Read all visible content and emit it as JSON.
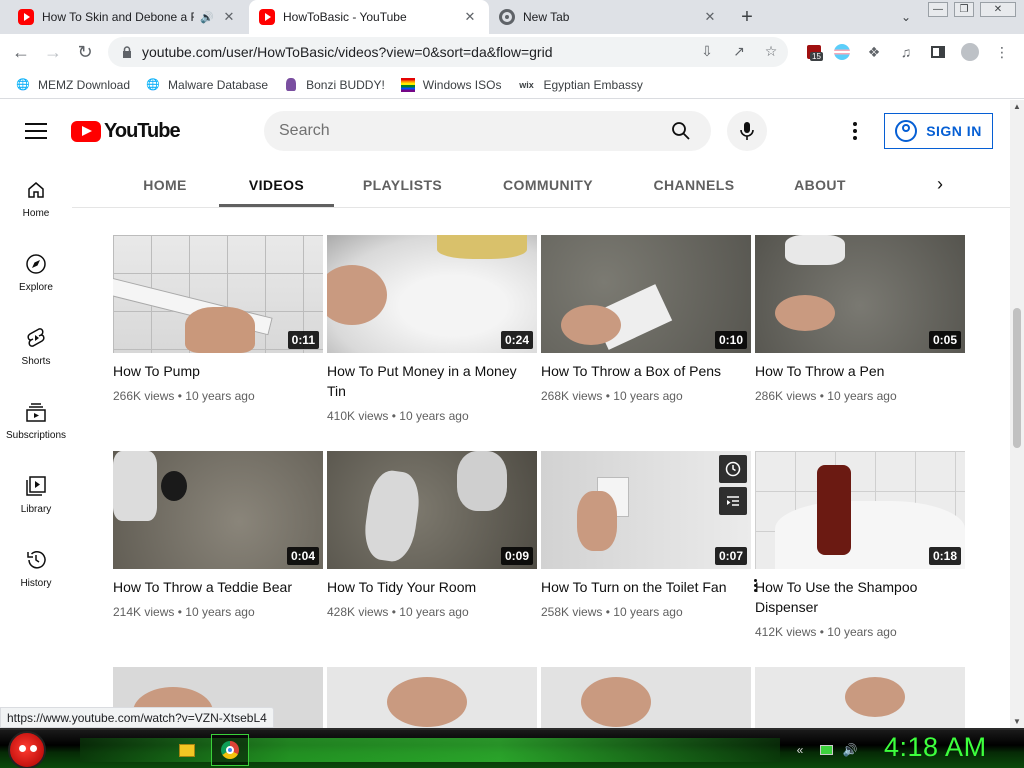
{
  "browser": {
    "tabs": [
      {
        "title": "How To Skin and Debone a F",
        "icon": "youtube-icon",
        "active": false
      },
      {
        "title": "HowToBasic - YouTube",
        "icon": "youtube-icon",
        "active": true
      },
      {
        "title": "New Tab",
        "icon": "chrome-icon",
        "active": false
      }
    ],
    "url": "youtube.com/user/HowToBasic/videos?view=0&sort=da&flow=grid",
    "extension_badge": "15",
    "bookmarks": [
      {
        "label": "MEMZ Download",
        "icon": "globe-icon"
      },
      {
        "label": "Malware Database",
        "icon": "globe-icon"
      },
      {
        "label": "Bonzi BUDDY!",
        "icon": "bonzi-icon"
      },
      {
        "label": "Windows ISOs",
        "icon": "windows-flag-icon"
      },
      {
        "label": "Egyptian Embassy",
        "icon": "wix-icon"
      }
    ],
    "status_url": "https://www.youtube.com/watch?v=VZN-XtsebL4"
  },
  "youtube": {
    "logo_text": "YouTube",
    "search_placeholder": "Search",
    "sign_in": "SIGN IN",
    "channel_tabs": [
      "HOME",
      "VIDEOS",
      "PLAYLISTS",
      "COMMUNITY",
      "CHANNELS",
      "ABOUT"
    ],
    "active_tab": "VIDEOS",
    "sidebar": [
      {
        "label": "Home",
        "icon": "home-icon"
      },
      {
        "label": "Explore",
        "icon": "compass-icon"
      },
      {
        "label": "Shorts",
        "icon": "shorts-icon"
      },
      {
        "label": "Subscriptions",
        "icon": "subscriptions-icon"
      },
      {
        "label": "Library",
        "icon": "library-icon"
      },
      {
        "label": "History",
        "icon": "history-icon"
      }
    ],
    "videos": [
      {
        "title": "How To Pump",
        "duration": "0:11",
        "views": "266K views",
        "age": "10 years ago"
      },
      {
        "title": "How To Put Money in a Money Tin",
        "duration": "0:24",
        "views": "410K views",
        "age": "10 years ago"
      },
      {
        "title": "How To Throw a Box of Pens",
        "duration": "0:10",
        "views": "268K views",
        "age": "10 years ago"
      },
      {
        "title": "How To Throw a Pen",
        "duration": "0:05",
        "views": "286K views",
        "age": "10 years ago"
      },
      {
        "title": "How To Throw a Teddie Bear",
        "duration": "0:04",
        "views": "214K views",
        "age": "10 years ago"
      },
      {
        "title": "How To Tidy Your Room",
        "duration": "0:09",
        "views": "428K views",
        "age": "10 years ago"
      },
      {
        "title": "How To Turn on the Toilet Fan",
        "duration": "0:07",
        "views": "258K views",
        "age": "10 years ago"
      },
      {
        "title": "How To Use the Shampoo Dispenser",
        "duration": "0:18",
        "views": "412K views",
        "age": "10 years ago"
      }
    ],
    "meta_separator": "•"
  },
  "taskbar": {
    "clock": "4:18 AM"
  }
}
